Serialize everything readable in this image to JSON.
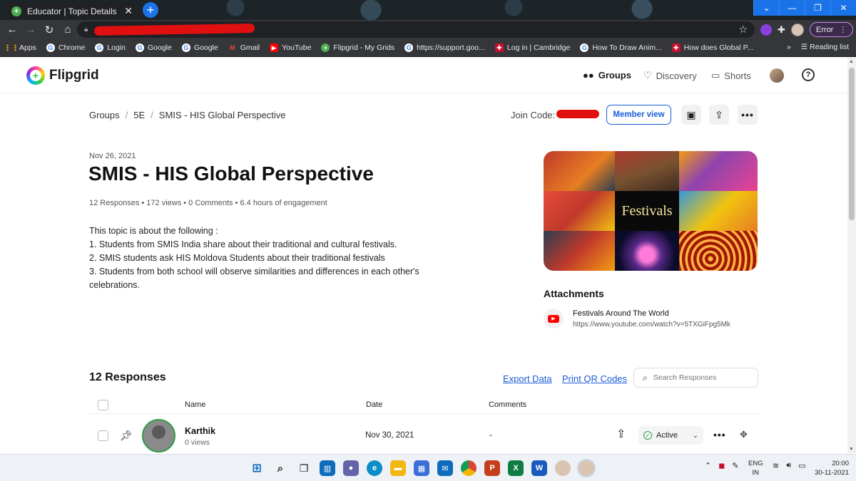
{
  "browser": {
    "tab_title": "Educator | Topic Details",
    "tab_close": "✕",
    "new_tab": "+",
    "error_label": "Error",
    "bookmarks": [
      {
        "label": "Apps",
        "icon": "apps-grid-icon"
      },
      {
        "label": "Chrome",
        "icon": "google-icon"
      },
      {
        "label": "Login",
        "icon": "google-icon"
      },
      {
        "label": "Google",
        "icon": "google-icon"
      },
      {
        "label": "Google",
        "icon": "google-icon"
      },
      {
        "label": "Gmail",
        "icon": "gmail-icon"
      },
      {
        "label": "YouTube",
        "icon": "youtube-icon"
      },
      {
        "label": "Flipgrid - My Grids",
        "icon": "flipgrid-icon"
      },
      {
        "label": "https://support.goo...",
        "icon": "google-icon"
      },
      {
        "label": "Log in | Cambridge",
        "icon": "cambridge-icon"
      },
      {
        "label": "How To Draw Anim...",
        "icon": "google-icon"
      },
      {
        "label": "How does Global P...",
        "icon": "cambridge-icon"
      }
    ],
    "bookmarks_overflow": "»",
    "reading_list": "Reading list"
  },
  "header": {
    "logo_text": "Flipgrid",
    "nav": [
      {
        "label": "Groups",
        "icon": "groups-icon",
        "active": true
      },
      {
        "label": "Discovery",
        "icon": "lightbulb-icon",
        "active": false
      },
      {
        "label": "Shorts",
        "icon": "video-camera-icon",
        "active": false
      }
    ],
    "help": "?"
  },
  "breadcrumb": {
    "items": [
      "Groups",
      "5E",
      "SMIS - HIS Global Perspective"
    ],
    "separator": "/"
  },
  "join_code_label": "Join Code:",
  "member_view_label": "Member view",
  "topic": {
    "date": "Nov 26, 2021",
    "title": "SMIS - HIS Global Perspective",
    "stats": "12 Responses • 172 views • 0 Comments • 6.4 hours of engagement",
    "description": [
      "This topic is about the following :",
      "1. Students from SMIS India share about their traditional and cultural festivals.",
      "2. SMIS students ask HIS Moldova Students about their traditional festivals",
      "3. Students from both school will observe similarities and differences in each other's celebrations."
    ],
    "banner_text": "Festivals"
  },
  "attachments": {
    "heading": "Attachments",
    "items": [
      {
        "title": "Festivals Around The World",
        "url": "https://www.youtube.com/watch?v=5TXGiFpg5Mk"
      }
    ]
  },
  "responses": {
    "heading": "12 Responses",
    "export_label": "Export Data",
    "qr_label": "Print QR Codes",
    "search_placeholder": "Search Responses",
    "columns": [
      "Name",
      "Date",
      "Comments"
    ],
    "rows": [
      {
        "name": "Karthik",
        "views": "0 views",
        "date": "Nov 30, 2021",
        "comments": "-",
        "status": "Active"
      }
    ]
  },
  "taskbar": {
    "lang_top": "ENG",
    "lang_bottom": "IN",
    "time": "20:00",
    "date": "30-11-2021"
  }
}
